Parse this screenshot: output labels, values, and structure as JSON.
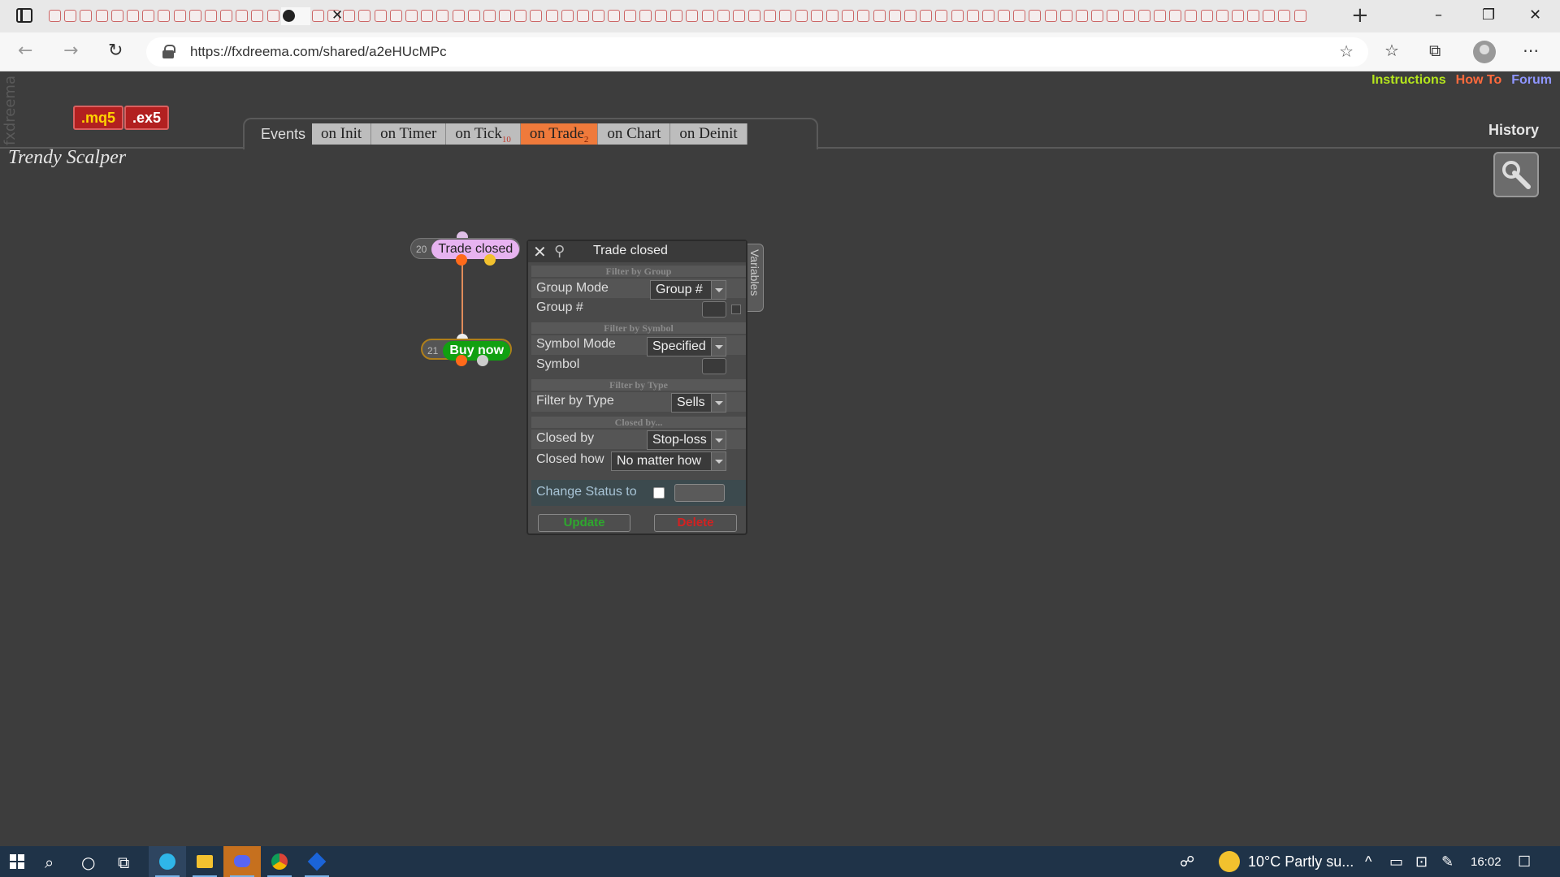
{
  "browser": {
    "url": "https://fxdreema.com/shared/a2eHUcMPc",
    "tab_count_visible": 80
  },
  "page": {
    "vertical_logo": "fxdreema",
    "export_buttons": [
      ".mq5",
      ".ex5"
    ],
    "project_title": "Trendy Scalper",
    "top_links": [
      {
        "label": "Instructions",
        "color": "#b5e61d"
      },
      {
        "label": "How To",
        "color": "#ff6a3d"
      },
      {
        "label": "Forum",
        "color": "#8f96ff"
      }
    ],
    "history_label": "History",
    "events": {
      "label": "Events",
      "tabs": [
        {
          "label": "on Init",
          "count": ""
        },
        {
          "label": "on Timer",
          "count": ""
        },
        {
          "label": "on Tick",
          "count": "10"
        },
        {
          "label": "on Trade",
          "count": "2",
          "active": true
        },
        {
          "label": "on Chart",
          "count": ""
        },
        {
          "label": "on Deinit",
          "count": ""
        }
      ]
    }
  },
  "blocks": [
    {
      "id": "20",
      "label": "Trade closed",
      "color": "#e7b3f0"
    },
    {
      "id": "21",
      "label": "Buy now",
      "color": "#11a011"
    }
  ],
  "panel": {
    "title": "Trade closed",
    "variables_tab": "Variables",
    "sections": {
      "group": "Filter by Group",
      "symbol": "Filter by Symbol",
      "type": "Filter by Type",
      "closed": "Closed by..."
    },
    "fields": {
      "group_mode": {
        "label": "Group Mode",
        "value": "Group #"
      },
      "group_num": {
        "label": "Group #"
      },
      "symbol_mode": {
        "label": "Symbol Mode",
        "value": "Specified"
      },
      "symbol": {
        "label": "Symbol"
      },
      "filter_type": {
        "label": "Filter by Type",
        "value": "Sells"
      },
      "closed_by": {
        "label": "Closed by",
        "value": "Stop-loss"
      },
      "closed_how": {
        "label": "Closed how",
        "value": "No matter how"
      },
      "change_status": {
        "label": "Change Status to"
      }
    },
    "buttons": {
      "update": "Update",
      "delete": "Delete"
    }
  },
  "taskbar": {
    "weather": "10°C  Partly su...",
    "time": "16:02"
  }
}
